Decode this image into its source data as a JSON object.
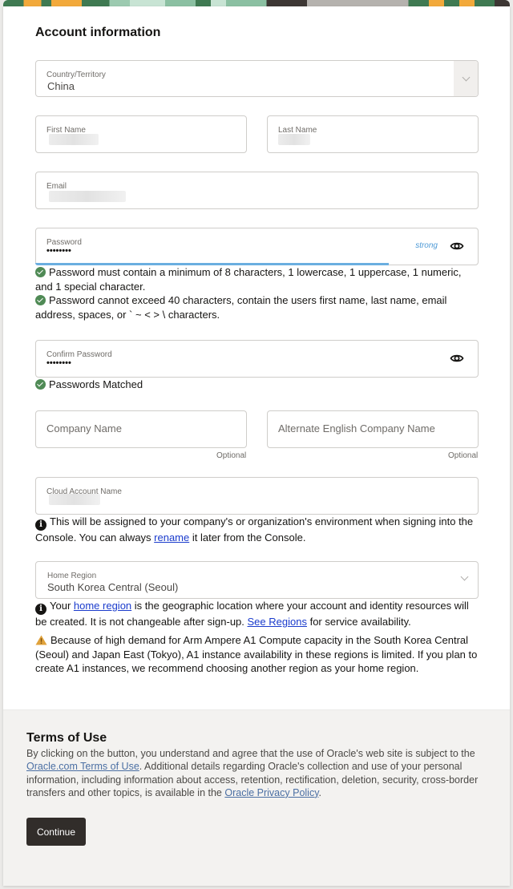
{
  "section_title": "Account information",
  "country": {
    "label": "Country/Territory",
    "value": "China"
  },
  "first_name": {
    "label": "First Name"
  },
  "last_name": {
    "label": "Last Name"
  },
  "email": {
    "label": "Email"
  },
  "password": {
    "label": "Password",
    "value": "••••••••",
    "strength_label": "strong",
    "strength_fraction": 0.8
  },
  "password_rules": [
    "Password must contain a minimum of 8 characters, 1 lowercase, 1 uppercase, 1 numeric, and 1 special character.",
    "Password cannot exceed 40 characters, contain the users first name, last name, email address, spaces, or ` ~ < > \\ characters."
  ],
  "confirm_password": {
    "label": "Confirm Password",
    "value": "••••••••",
    "match_message": "Passwords Matched"
  },
  "company_name": {
    "placeholder": "Company Name",
    "hint": "Optional"
  },
  "alt_company_name": {
    "placeholder": "Alternate English Company Name",
    "hint": "Optional"
  },
  "cloud_account": {
    "label": "Cloud Account Name",
    "info_before": "This will be assigned to your company's or organization's environment when signing into the Console. You can always ",
    "info_link": "rename",
    "info_after": " it later from the Console."
  },
  "home_region": {
    "label": "Home Region",
    "value": "South Korea Central (Seoul)",
    "info_part1": "Your ",
    "info_link1": "home region",
    "info_part2": " is the geographic location where your account and identity resources will be created. It is not changeable after sign-up. ",
    "info_link2": "See Regions",
    "info_part3": " for service availability.",
    "warning": "Because of high demand for Arm Ampere A1 Compute capacity in the South Korea Central (Seoul) and Japan East (Tokyo), A1 instance availability in these regions is limited. If you plan to create A1 instances, we recommend choosing another region as your home region."
  },
  "terms": {
    "title": "Terms of Use",
    "part1": "By clicking on the button, you understand and agree that the use of Oracle's web site is subject to the ",
    "link1": "Oracle.com Terms of Use",
    "part2": ". Additional details regarding Oracle's collection and use of your personal information, including information about access, retention, rectification, deletion, security, cross-border transfers and other topics, is available in the ",
    "link2": "Oracle Privacy Policy",
    "part3": ".",
    "continue_label": "Continue"
  },
  "colors": {
    "success": "#4f8a55",
    "link": "#1a3bcc",
    "strength_bar": "#6aaee0",
    "warning": "#e0a23b",
    "button": "#312d2a"
  }
}
